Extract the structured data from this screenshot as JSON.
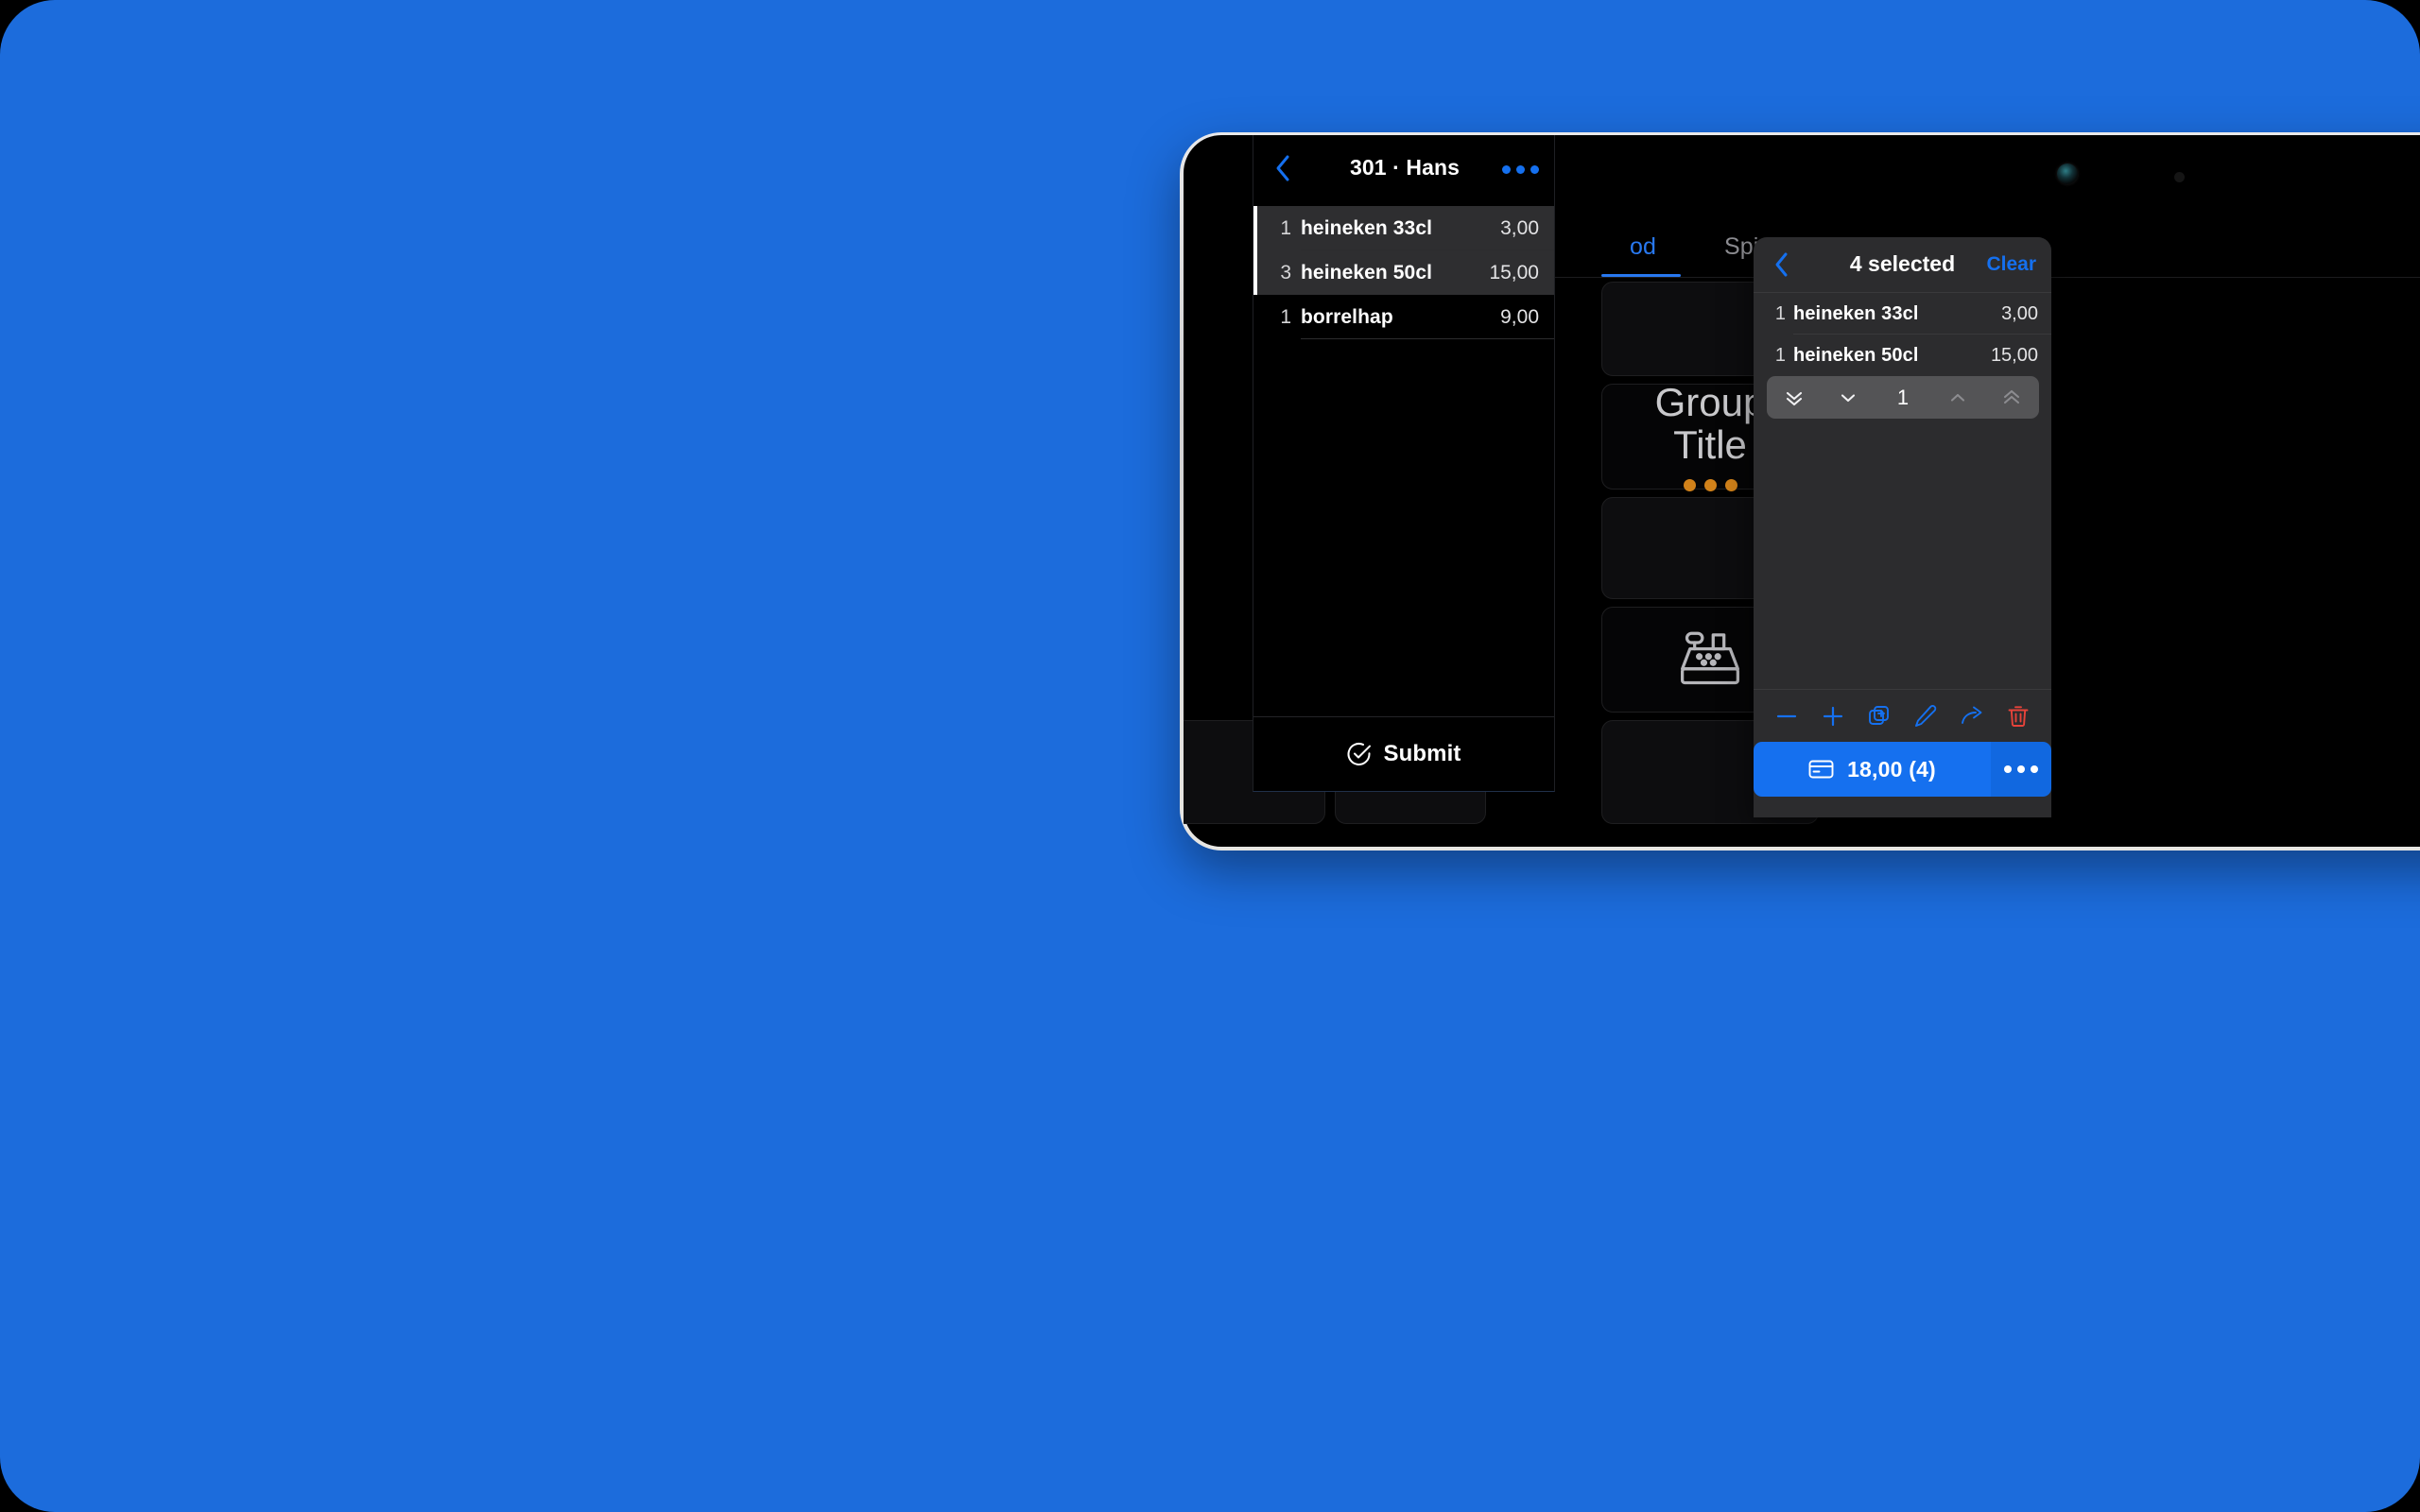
{
  "backdrop": {
    "color": "#1C6CDC"
  },
  "device": {
    "camera_icon": "camera-lens",
    "sensor_icon": "ambient-light-sensor"
  },
  "catalog": {
    "tabs": [
      {
        "label": "od",
        "active": true
      },
      {
        "label": "Spirits",
        "active": false
      }
    ],
    "tiles": [
      {
        "title": "",
        "icon": ""
      },
      {
        "title": "Group\nTitle",
        "icon": "",
        "dots": 3,
        "dot_color": "#d2821a"
      },
      {
        "title": "",
        "icon": ""
      },
      {
        "title": "",
        "icon": "cash-register-icon"
      },
      {
        "title": "",
        "icon": ""
      }
    ]
  },
  "order": {
    "back_icon": "chevron-left-icon",
    "title": "301 · Hans",
    "more_icon": "more-horizontal-icon",
    "lines": [
      {
        "qty": "1",
        "name": "heineken 33cl",
        "price": "3,00",
        "selected": true
      },
      {
        "qty": "3",
        "name": "heineken 50cl",
        "price": "15,00",
        "selected": true
      },
      {
        "qty": "1",
        "name": "borrelhap",
        "price": "9,00",
        "selected": false
      }
    ],
    "submit_label": "Submit",
    "submit_icon": "check-circle-icon"
  },
  "popover": {
    "back_icon": "chevron-left-icon",
    "title": "4 selected",
    "clear_label": "Clear",
    "clear_color": "#1570ef",
    "lines": [
      {
        "qty": "1",
        "name": "heineken 33cl",
        "price": "3,00"
      },
      {
        "qty": "1",
        "name": "heineken 50cl",
        "price": "15,00"
      }
    ],
    "stepper": {
      "first_icon": "chevrons-down-icon",
      "down_icon": "chevron-down-icon",
      "value": "1",
      "up_icon": "chevron-up-icon",
      "last_icon": "chevrons-up-icon"
    },
    "toolbar": [
      {
        "icon": "minus-icon",
        "color": "#1570ef"
      },
      {
        "icon": "plus-icon",
        "color": "#1570ef"
      },
      {
        "icon": "duplicate-add-icon",
        "color": "#1570ef"
      },
      {
        "icon": "pencil-icon",
        "color": "#1570ef"
      },
      {
        "icon": "share-arrow-icon",
        "color": "#1570ef"
      },
      {
        "icon": "trash-icon",
        "color": "#e8433a"
      }
    ],
    "action": {
      "pay_icon": "card-icon",
      "pay_label": "18,00 (4)",
      "more_icon": "more-horizontal-icon",
      "accent": "#1570ef"
    }
  }
}
